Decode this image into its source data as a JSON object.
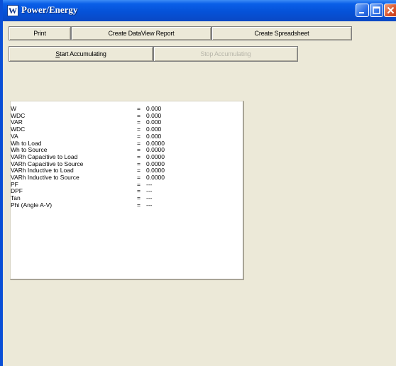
{
  "window": {
    "icon_letter": "W",
    "title": "Power/Energy",
    "colors": {
      "titlebar": "#0552d8",
      "frame": "#ece9d8",
      "panel": "#ffffff"
    }
  },
  "toolbar": {
    "print_label": "Print",
    "dataview_label": "Create DataView Report",
    "spreadsheet_label": "Create Spreadsheet",
    "start_label_prefix": "S",
    "start_label_rest": "tart Accumulating",
    "stop_label": "Stop Accumulating"
  },
  "readings": [
    {
      "label": "W",
      "eq": "=",
      "value": "0.000"
    },
    {
      "label": "WDC",
      "eq": "=",
      "value": "0.000"
    },
    {
      "label": "VAR",
      "eq": "=",
      "value": "0.000"
    },
    {
      "label": "WDC",
      "eq": "=",
      "value": "0.000"
    },
    {
      "label": "VA",
      "eq": "=",
      "value": "0.000"
    },
    {
      "label": "Wh to Load",
      "eq": "=",
      "value": "0.0000"
    },
    {
      "label": "Wh to Source",
      "eq": "=",
      "value": "0.0000"
    },
    {
      "label": "VARh Capacitive to Load",
      "eq": "=",
      "value": "0.0000"
    },
    {
      "label": "VARh Capacitive to Source",
      "eq": "=",
      "value": "0.0000"
    },
    {
      "label": "VARh Inductive to Load",
      "eq": "=",
      "value": "0.0000"
    },
    {
      "label": "VARh Inductive to Source",
      "eq": "=",
      "value": "0.0000"
    },
    {
      "label": "PF",
      "eq": "=",
      "value": "---"
    },
    {
      "label": "DPF",
      "eq": "=",
      "value": "---"
    },
    {
      "label": "Tan",
      "eq": "=",
      "value": "---"
    },
    {
      "label": "Phi (Angle A-V)",
      "eq": "=",
      "value": "---"
    }
  ]
}
